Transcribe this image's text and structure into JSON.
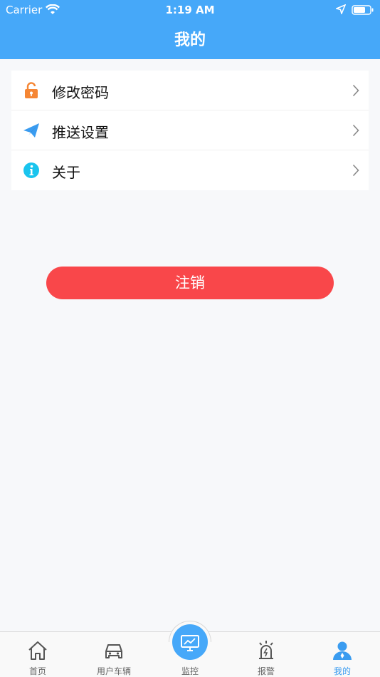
{
  "status_bar": {
    "carrier": "Carrier",
    "time": "1:19 AM"
  },
  "header": {
    "title": "我的"
  },
  "menu": {
    "items": [
      {
        "label": "修改密码",
        "icon": "unlock-icon"
      },
      {
        "label": "推送设置",
        "icon": "paper-plane-icon"
      },
      {
        "label": "关于",
        "icon": "info-icon"
      }
    ]
  },
  "logout": {
    "label": "注销"
  },
  "tabbar": {
    "tabs": [
      {
        "label": "首页",
        "icon": "home-icon"
      },
      {
        "label": "用户车辆",
        "icon": "car-icon"
      },
      {
        "label": "监控",
        "icon": "monitor-icon"
      },
      {
        "label": "报警",
        "icon": "alarm-icon"
      },
      {
        "label": "我的",
        "icon": "user-icon",
        "active": true
      }
    ]
  },
  "colors": {
    "header": "#46a8f9",
    "logout": "#f9474a",
    "active_tab": "#3a9cf0",
    "background": "#f7f8fa"
  }
}
